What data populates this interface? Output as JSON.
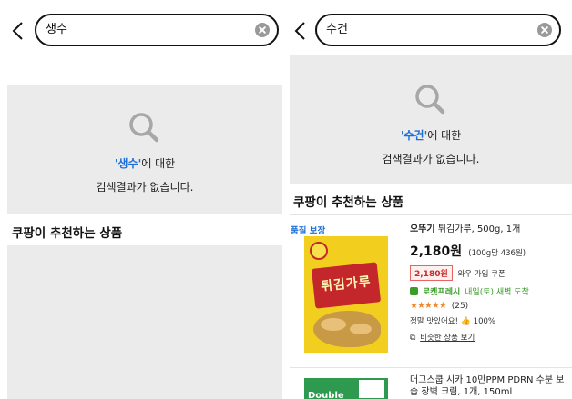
{
  "left": {
    "search_value": "생수",
    "no_result": {
      "keyword": "'생수'",
      "suffix": "에 대한",
      "line2": "검색결과가 없습니다."
    },
    "rec_title": "쿠팡이 추천하는 상품"
  },
  "right": {
    "search_value": "수건",
    "no_result": {
      "keyword": "'수건'",
      "suffix": "에 대한",
      "line2": "검색결과가 없습니다."
    },
    "rec_title": "쿠팡이 추천하는 상품",
    "products": [
      {
        "badge": "품질 보장",
        "brand": "오뚜기",
        "name": " 튀김가루, 500g, 1개",
        "image_text": "튀김가루",
        "price": "2,180원",
        "unit_price": "(100g당 436원)",
        "coupon_price": "2,180원",
        "coupon_text": "와우 가입 쿠폰",
        "delivery_label": "로켓프레시",
        "delivery_info": "내일(토) 새벽 도착",
        "stars": "★★★★★",
        "review_count": "(25)",
        "taste_text": "정말 맛있어요!",
        "taste_pct": "100%",
        "similar_text": "비슷한 상품 보기"
      },
      {
        "name": "머그스쿱 시카 10만PPM PDRN 수분 보습 장벽 크림, 1개, 150ml",
        "image_text": "Double"
      }
    ]
  }
}
